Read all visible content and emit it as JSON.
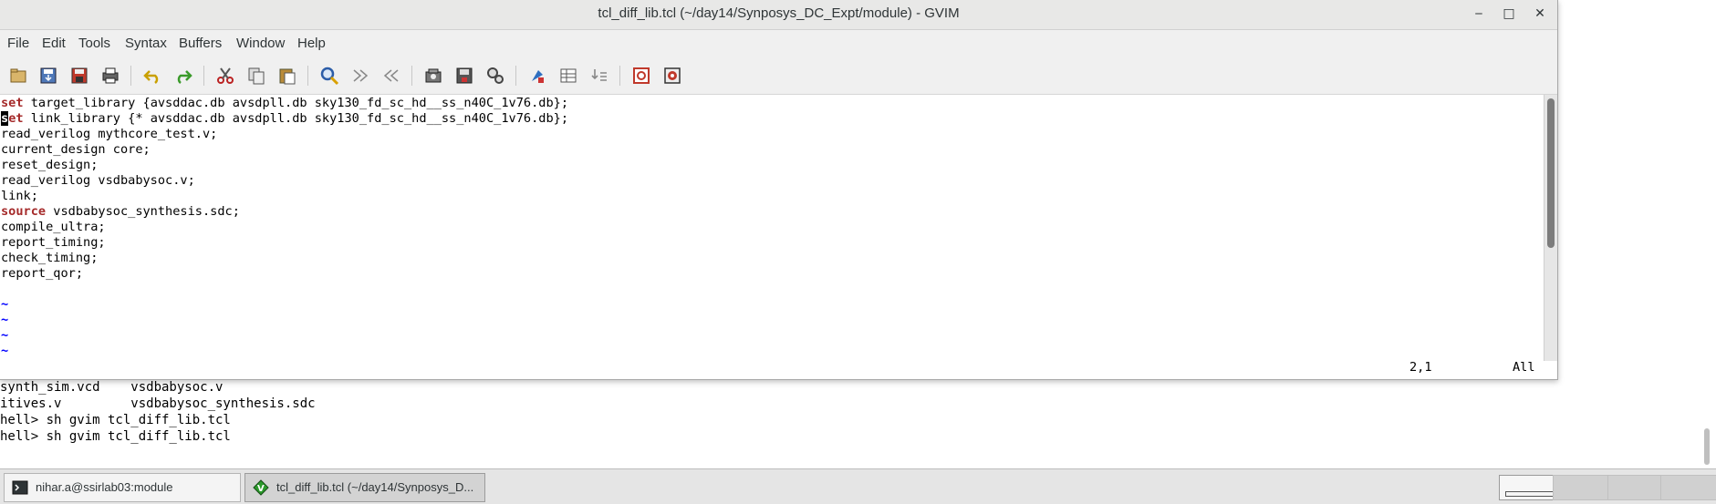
{
  "terminal": {
    "lines": [
      "synth_sim.vcd    vsdbabysoc.v",
      "itives.v         vsdbabysoc_synthesis.sdc",
      "hell> sh gvim tcl_diff_lib.tcl",
      "hell> sh gvim tcl_diff_lib.tcl"
    ]
  },
  "gvim": {
    "title": "tcl_diff_lib.tcl (~/day14/Synposys_DC_Expt/module) - GVIM",
    "window_controls": {
      "minimize": "‒",
      "maximize": "□",
      "close": "✕"
    },
    "menu": [
      "File",
      "Edit",
      "Tools",
      "Syntax",
      "Buffers",
      "Window",
      "Help"
    ],
    "toolbar_icons": [
      "open-icon",
      "save-icon",
      "save-all-icon",
      "print-icon",
      "undo-icon",
      "redo-icon",
      "cut-icon",
      "copy-icon",
      "paste-icon",
      "find-replace-icon",
      "find-next-icon",
      "find-prev-icon",
      "load-session-icon",
      "save-session-icon",
      "run-script-icon",
      "make-icon",
      "tags-icon",
      "jump-tag-icon",
      "help-icon",
      "find-help-icon"
    ],
    "code_lines": [
      {
        "kw": "set",
        "rest": " target_library {avsddac.db avsdpll.db sky130_fd_sc_hd__ss_n40C_1v76.db};"
      },
      {
        "cursor": "s",
        "kw": "et",
        "rest": " link_library {* avsddac.db avsdpll.db sky130_fd_sc_hd__ss_n40C_1v76.db};"
      },
      {
        "kw": "",
        "rest": "read_verilog mythcore_test.v;"
      },
      {
        "kw": "",
        "rest": "current_design core;"
      },
      {
        "kw": "",
        "rest": "reset_design;"
      },
      {
        "kw": "",
        "rest": "read_verilog vsdbabysoc.v;"
      },
      {
        "kw": "",
        "rest": "link;"
      },
      {
        "kw": "source",
        "rest": " vsdbabysoc_synthesis.sdc;"
      },
      {
        "kw": "",
        "rest": "compile_ultra;"
      },
      {
        "kw": "",
        "rest": "report_timing;"
      },
      {
        "kw": "",
        "rest": "check_timing;"
      },
      {
        "kw": "",
        "rest": "report_qor;"
      },
      {
        "kw": "",
        "rest": ""
      }
    ],
    "tildes": [
      "~",
      "~",
      "~",
      "~"
    ],
    "ruler": "2,1",
    "ruler_all": "All"
  },
  "taskbar": {
    "tasks": [
      {
        "label": "nihar.a@ssirlab03:module",
        "icon": "terminal-icon"
      },
      {
        "label": "tcl_diff_lib.tcl (~/day14/Synposys_D...",
        "icon": "vim-icon"
      }
    ]
  }
}
